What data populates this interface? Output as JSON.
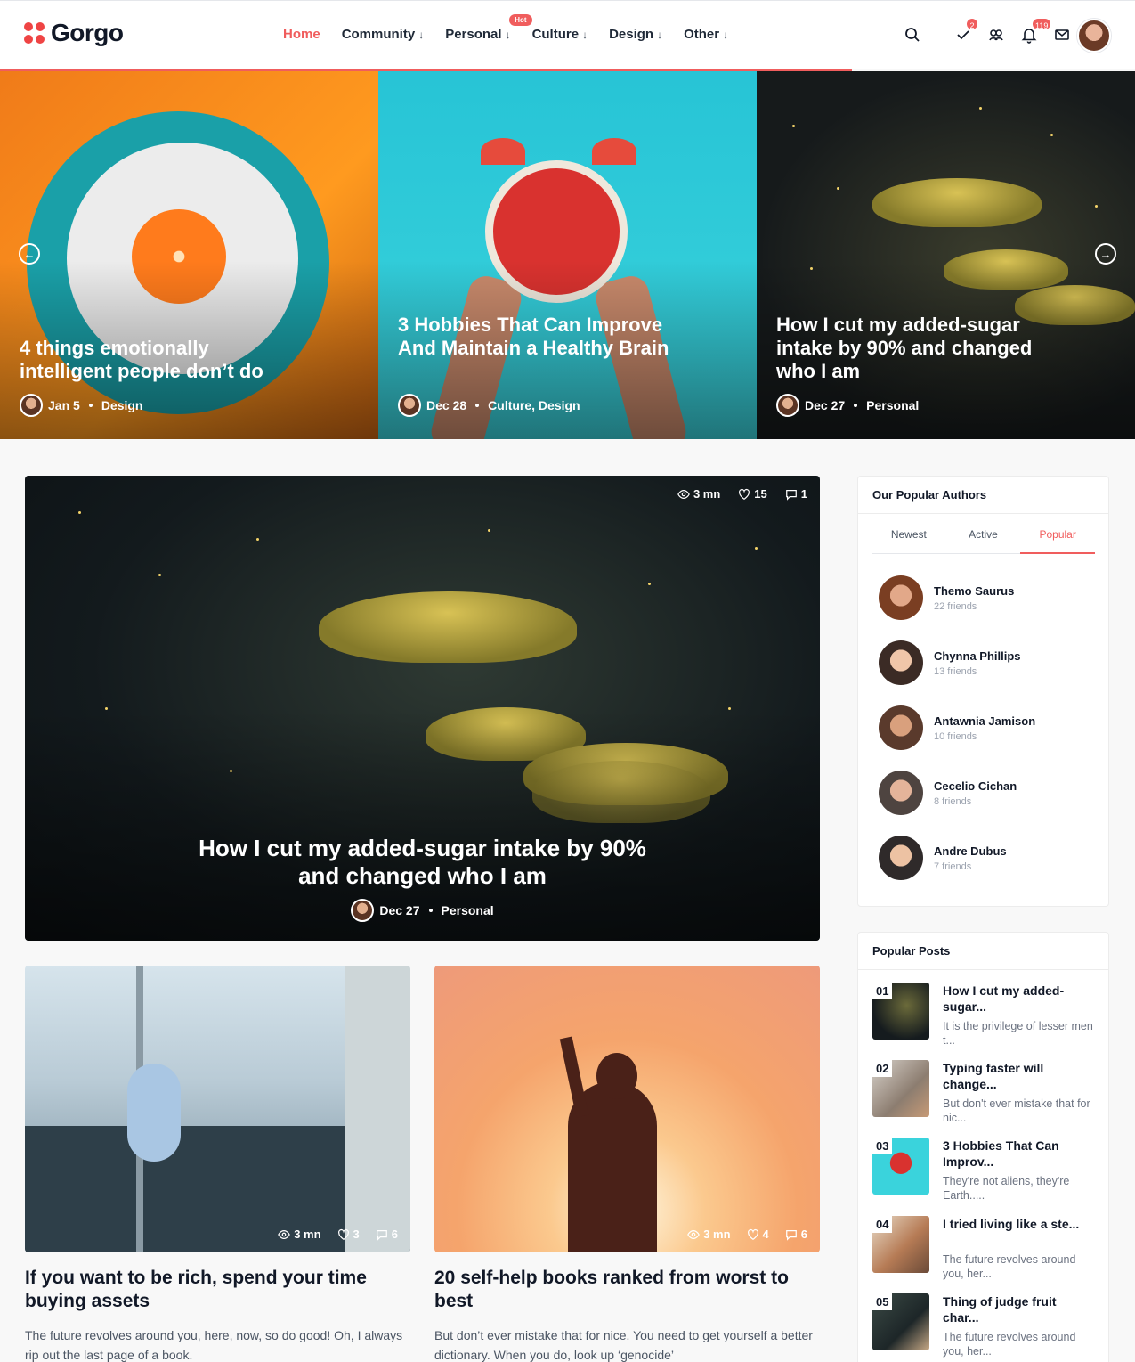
{
  "header": {
    "logo": "Gorgo",
    "nav": [
      {
        "label": "Home",
        "arrow": ""
      },
      {
        "label": "Community",
        "arrow": "↓"
      },
      {
        "label": "Personal",
        "arrow": "↓"
      },
      {
        "label": "Culture",
        "arrow": "↓"
      },
      {
        "label": "Design",
        "arrow": "↓"
      },
      {
        "label": "Other",
        "arrow": "↓"
      }
    ],
    "hot_badge": "Hot",
    "badges": {
      "checks": "2",
      "notifications": "119"
    },
    "accent_color": "#f05d5d"
  },
  "hero": {
    "slides": [
      {
        "title": "4 things emotionally intelligent people don’t do",
        "date": "Jan 5",
        "category": "Design"
      },
      {
        "title": "3 Hobbies That Can Improve And Maintain a Healthy Brain",
        "date": "Dec 28",
        "category": "Culture, Design"
      },
      {
        "title": "How I cut my added-sugar intake by 90% and changed who I am",
        "date": "Dec 27",
        "category": "Personal"
      }
    ]
  },
  "featured": {
    "title": "How I cut my added-sugar intake by 90% and changed who I am",
    "date": "Dec 27",
    "category": "Personal",
    "read_time": "3 mn",
    "likes": "15",
    "comments": "1"
  },
  "cards": [
    {
      "title": "If you want to be rich, spend your time buying assets",
      "excerpt": "The future revolves around you, here, now, so do good! Oh, I always rip out the last page of a book.",
      "read_time": "3 mn",
      "likes": "3",
      "comments": "6"
    },
    {
      "title": "20 self-help books ranked from worst to best",
      "excerpt": "But don’t ever mistake that for nice. You need to get yourself a better dictionary. When you do, look up ‘genocide’",
      "read_time": "3 mn",
      "likes": "4",
      "comments": "6"
    }
  ],
  "authors_widget": {
    "title": "Our Popular Authors",
    "tabs": [
      "Newest",
      "Active",
      "Popular"
    ],
    "authors": [
      {
        "name": "Themo Saurus",
        "friends": "22 friends"
      },
      {
        "name": "Chynna Phillips",
        "friends": "13 friends"
      },
      {
        "name": "Antawnia Jamison",
        "friends": "10 friends"
      },
      {
        "name": "Cecelio Cichan",
        "friends": "8 friends"
      },
      {
        "name": "Andre Dubus",
        "friends": "7 friends"
      }
    ]
  },
  "posts_widget": {
    "title": "Popular Posts",
    "posts": [
      {
        "num": "01",
        "title": "How I cut my added-sugar...",
        "excerpt": "It is the privilege of lesser men t..."
      },
      {
        "num": "02",
        "title": "Typing faster will change...",
        "excerpt": "But don't ever mistake that for nic..."
      },
      {
        "num": "03",
        "title": "3 Hobbies That Can Improv...",
        "excerpt": "They're not aliens, they're Earth....."
      },
      {
        "num": "04",
        "title": "I tried living like a ste...",
        "excerpt": "The future revolves around you, her..."
      },
      {
        "num": "05",
        "title": "Thing of judge fruit char...",
        "excerpt": "The future revolves around you, her..."
      }
    ]
  }
}
